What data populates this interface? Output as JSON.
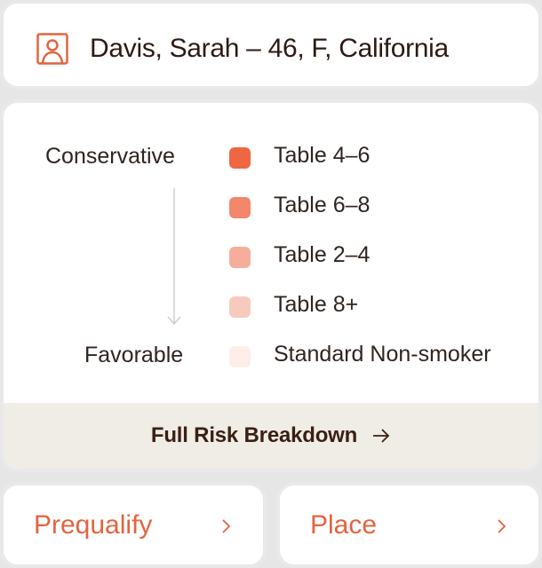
{
  "header": {
    "patient_summary": "Davis, Sarah – 46, F, California",
    "icon": "user-portrait-icon"
  },
  "risk_scale": {
    "top_label": "Conservative",
    "bottom_label": "Favorable",
    "items": [
      {
        "label": "Table 4–6",
        "color": "#ef6642"
      },
      {
        "label": "Table 6–8",
        "color": "#f2876b"
      },
      {
        "label": "Table 2–4",
        "color": "#f5ae9c"
      },
      {
        "label": "Table 8+",
        "color": "#f8cabd"
      },
      {
        "label": "Standard Non-smoker",
        "color": "#fdeeea"
      }
    ],
    "footer_label": "Full Risk Breakdown",
    "footer_icon": "arrow-right-icon"
  },
  "actions": [
    {
      "label": "Prequalify",
      "icon": "chevron-right-icon"
    },
    {
      "label": "Place",
      "icon": "chevron-right-icon"
    }
  ],
  "colors": {
    "accent": "#e2643f",
    "card_border": "#e9e9e9",
    "footer_bg": "#f0ede6",
    "text_dark": "#2d1a14"
  }
}
